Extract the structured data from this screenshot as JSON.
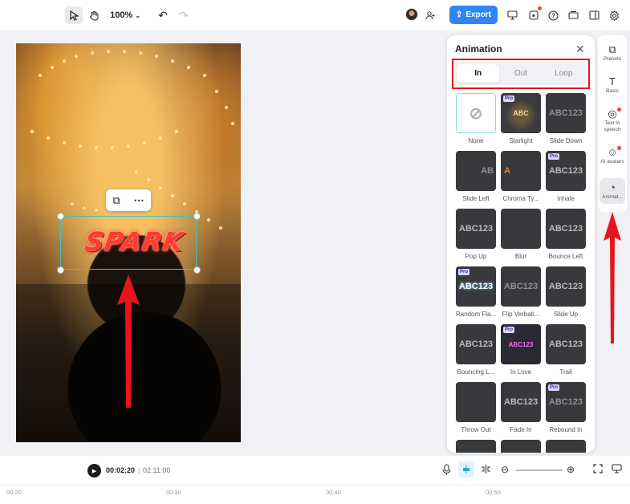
{
  "toolbar": {
    "zoom": "100%",
    "export_label": "Export"
  },
  "canvas": {
    "text_content": "SPARK"
  },
  "panel": {
    "title": "Animation",
    "tabs": [
      {
        "label": "In",
        "selected": true
      },
      {
        "label": "Out",
        "selected": false
      },
      {
        "label": "Loop",
        "selected": false
      }
    ],
    "items": [
      {
        "label": "None",
        "thumb": "",
        "pro": false,
        "kind": "none"
      },
      {
        "label": "Starlight",
        "thumb": "ABC",
        "pro": true,
        "kind": "sparkle"
      },
      {
        "label": "Slide Down",
        "thumb": "ABC123",
        "pro": false,
        "kind": "faded"
      },
      {
        "label": "Slide Left",
        "thumb": "AB",
        "pro": false,
        "kind": "right"
      },
      {
        "label": "Chroma Ty...",
        "thumb": "A",
        "pro": false,
        "kind": "orange"
      },
      {
        "label": "Inhale",
        "thumb": "ABC123",
        "pro": true,
        "kind": "normal"
      },
      {
        "label": "Pop Up",
        "thumb": "ABC123",
        "pro": false,
        "kind": "normal"
      },
      {
        "label": "Blur",
        "thumb": "",
        "pro": false,
        "kind": "blank"
      },
      {
        "label": "Bounce Left",
        "thumb": "ABC123",
        "pro": false,
        "kind": "normal"
      },
      {
        "label": "Random Fla...",
        "thumb": "ABC123",
        "pro": true,
        "kind": "bright"
      },
      {
        "label": "Flip Verbati...",
        "thumb": "ABC123",
        "pro": false,
        "kind": "faded"
      },
      {
        "label": "Slide Up",
        "thumb": "ABC123",
        "pro": false,
        "kind": "normal"
      },
      {
        "label": "Bouncing L...",
        "thumb": "ABC123",
        "pro": false,
        "kind": "normal"
      },
      {
        "label": "In Love",
        "thumb": "ABC123",
        "pro": true,
        "kind": "pink"
      },
      {
        "label": "Trail",
        "thumb": "ABC123",
        "pro": false,
        "kind": "normal"
      },
      {
        "label": "Throw Out",
        "thumb": "",
        "pro": false,
        "kind": "blank"
      },
      {
        "label": "Fade In",
        "thumb": "ABC123",
        "pro": false,
        "kind": "normal"
      },
      {
        "label": "Rebound In",
        "thumb": "ABC123",
        "pro": true,
        "kind": "faded"
      },
      {
        "label": "",
        "thumb": "",
        "pro": false,
        "kind": "blank"
      },
      {
        "label": "",
        "thumb": "",
        "pro": false,
        "kind": "blank"
      },
      {
        "label": "",
        "thumb": "",
        "pro": false,
        "kind": "blank"
      }
    ]
  },
  "sidebar": {
    "items": [
      {
        "label": "Presets",
        "icon": "presets-icon",
        "glyph": "⧉",
        "dot": false
      },
      {
        "label": "Basic",
        "icon": "text-icon",
        "glyph": "T",
        "dot": false
      },
      {
        "label": "Text to speech",
        "icon": "speech-icon",
        "glyph": "◎",
        "dot": true
      },
      {
        "label": "AI avatars",
        "icon": "avatar-icon",
        "glyph": "☺",
        "dot": true
      },
      {
        "label": "Animat...",
        "icon": "animation-icon",
        "glyph": "◔",
        "dot": false
      }
    ]
  },
  "timeline": {
    "current": "00:02:20",
    "separator": "|",
    "total": "02:11:00",
    "ticks": [
      "00:20",
      "00:30",
      "00:40",
      "00:50"
    ]
  },
  "colors": {
    "accent": "#2f86f6",
    "annotation_red": "#e8141b",
    "selection": "#3fc2c7"
  }
}
